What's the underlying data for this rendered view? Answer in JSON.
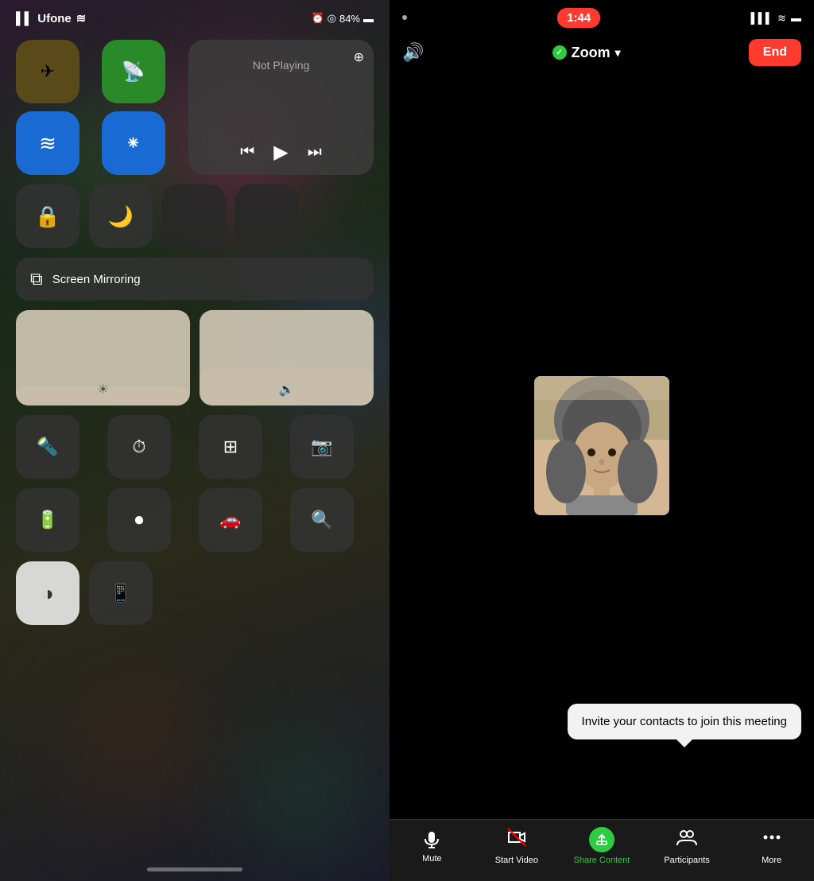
{
  "left_panel": {
    "status": {
      "carrier": "Ufone",
      "signal_icon": "📶",
      "wifi_icon": "WiFi",
      "alarm_icon": "⏰",
      "location_icon": "📍",
      "battery": "84%",
      "battery_icon": "🔋"
    },
    "connectivity": {
      "airplane_mode": "✈️",
      "cellular": "📡",
      "wifi": "📶",
      "bluetooth": "Bluetooth"
    },
    "music": {
      "not_playing": "Not Playing",
      "prev": "⏮",
      "play": "▶",
      "next": "⏭",
      "airplay": "AirPlay"
    },
    "controls": {
      "screen_lock": "🔒",
      "do_not_disturb": "🌙",
      "screen_mirroring_label": "Screen Mirroring",
      "flashlight": "Flashlight",
      "timer": "Timer",
      "calculator": "Calculator",
      "camera": "Camera",
      "battery_saver": "Battery",
      "record": "Record",
      "carplay": "CarPlay",
      "magnifier": "Magnifier",
      "contrast": "Contrast",
      "remote": "Remote"
    }
  },
  "right_panel": {
    "status": {
      "time": "1:44",
      "signal_bars": "▌▌▌",
      "wifi": "WiFi",
      "battery": "Battery"
    },
    "toolbar": {
      "speaker_icon": "speaker",
      "zoom_title": "Zoom",
      "dropdown_icon": "▾",
      "end_label": "End"
    },
    "tooltip": {
      "text": "Invite your contacts to join this meeting"
    },
    "bottom_bar": {
      "mute_label": "Mute",
      "start_video_label": "Start Video",
      "share_content_label": "Share Content",
      "participants_label": "Participants",
      "more_label": "More"
    }
  }
}
